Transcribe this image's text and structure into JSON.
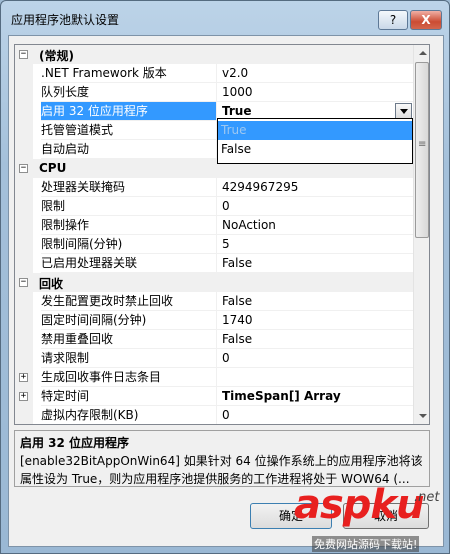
{
  "window": {
    "title": "应用程序池默认设置",
    "help_glyph": "?",
    "close_glyph": "X"
  },
  "grid": {
    "categories": [
      {
        "label": "(常规)",
        "expander": "−",
        "rows": [
          {
            "name": ".NET Framework 版本",
            "value": "v2.0"
          },
          {
            "name": "队列长度",
            "value": "1000"
          },
          {
            "name": "启用 32 位应用程序",
            "value": "True",
            "selected": true
          },
          {
            "name": "托管管道模式",
            "value": ""
          },
          {
            "name": "自动启动",
            "value": ""
          }
        ]
      },
      {
        "label": "CPU",
        "expander": "−",
        "rows": [
          {
            "name": "处理器关联掩码",
            "value": "4294967295"
          },
          {
            "name": "限制",
            "value": "0"
          },
          {
            "name": "限制操作",
            "value": "NoAction"
          },
          {
            "name": "限制间隔(分钟)",
            "value": "5"
          },
          {
            "name": "已启用处理器关联",
            "value": "False"
          }
        ]
      },
      {
        "label": "回收",
        "expander": "−",
        "rows": [
          {
            "name": "发生配置更改时禁止回收",
            "value": "False"
          },
          {
            "name": "固定时间间隔(分钟)",
            "value": "1740"
          },
          {
            "name": "禁用重叠回收",
            "value": "False"
          },
          {
            "name": "请求限制",
            "value": "0"
          },
          {
            "name": "生成回收事件日志条目",
            "value": "",
            "expander": "+"
          },
          {
            "name": "特定时间",
            "value": "TimeSpan[] Array",
            "expander": "+",
            "bold": true
          },
          {
            "name": "虚拟内存限制(KB)",
            "value": "0"
          }
        ]
      }
    ],
    "dropdown": {
      "options": [
        "True",
        "False"
      ],
      "highlighted": "True"
    }
  },
  "description": {
    "title": "启用 32 位应用程序",
    "text": "[enable32BitAppOnWin64] 如果针对 64 位操作系统上的应用程序池将该属性设为 True，则为应用程序池提供服务的工作进程将处于 WOW64 (..."
  },
  "buttons": {
    "ok": "确定",
    "cancel": "取消"
  },
  "watermark": {
    "brand": "aspku",
    "tld": ".net",
    "tagline": "免费网站源码下载站!"
  }
}
